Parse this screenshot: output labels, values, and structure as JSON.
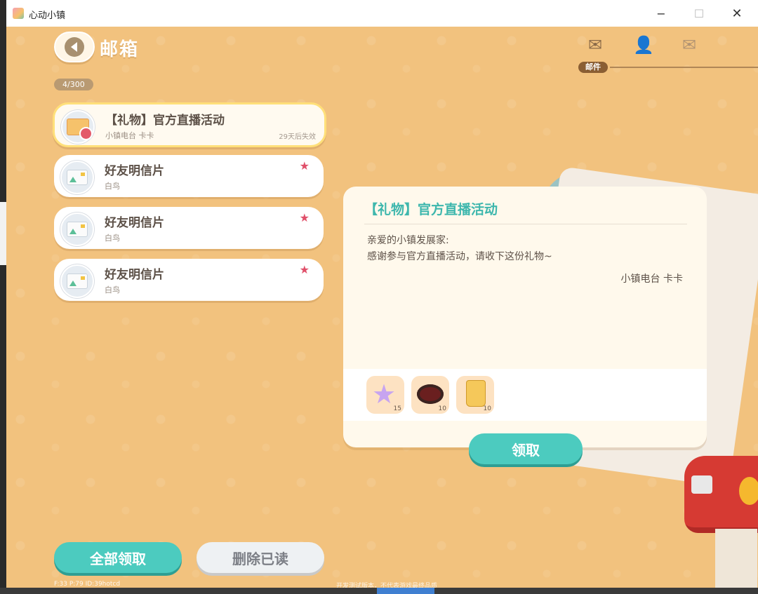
{
  "window": {
    "title": "心动小镇",
    "min_glyph": "−",
    "max_glyph": "☐",
    "close_glyph": "✕"
  },
  "header": {
    "title": "邮箱",
    "counter": "4/300"
  },
  "tabs": {
    "mail_label": "邮件",
    "mail_icon": "envelope-icon",
    "friend_icon": "add-friend-icon",
    "system_icon": "star-mail-icon"
  },
  "mails": [
    {
      "title": "【礼物】官方直播活动",
      "sender": "小镇电台 卡卡",
      "expire": "29天后失效",
      "icon": "gift-mail-icon"
    },
    {
      "title": "好友明信片",
      "sender": "白鸟",
      "icon": "postcard-icon"
    },
    {
      "title": "好友明信片",
      "sender": "白鸟",
      "icon": "postcard-icon"
    },
    {
      "title": "好友明信片",
      "sender": "白鸟",
      "icon": "postcard-icon"
    }
  ],
  "detail": {
    "title": "【礼物】官方直播活动",
    "greeting": "亲爱的小镇发展家:",
    "body": "感谢参与官方直播活动，请收下这份礼物~",
    "signature": "小镇电台 卡卡",
    "rewards": [
      {
        "name": "star-item-icon",
        "count": "15"
      },
      {
        "name": "plate-item-icon",
        "count": "10"
      },
      {
        "name": "sack-item-icon",
        "count": "10"
      }
    ],
    "claim_label": "领取"
  },
  "actions": {
    "claim_all": "全部领取",
    "delete_read": "删除已读"
  },
  "debug": {
    "stats": "F:33  P:79  ID:39hotcd",
    "note": "开发测试版本，不代表游戏最终品质"
  },
  "colors": {
    "accent": "#4ccbbf",
    "background": "#f2c27e",
    "title_teal": "#3eb7ad"
  }
}
